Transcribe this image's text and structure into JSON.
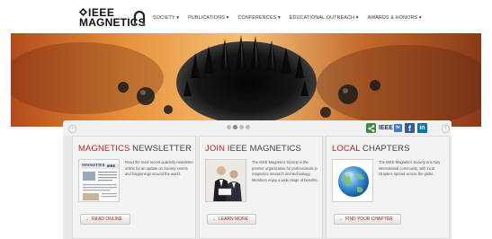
{
  "header": {
    "logo_line1": "IEEE",
    "logo_line2": "MAGNETICS",
    "nav": [
      {
        "label": "SOCIETY"
      },
      {
        "label": "PUBLICATIONS"
      },
      {
        "label": "CONFERENCES"
      },
      {
        "label": "EDUCATIONAL OUTREACH"
      },
      {
        "label": "AWARDS & HONORS"
      }
    ]
  },
  "slider": {
    "prev_icon": "chevron-left-icon",
    "next_icon": "chevron-right-icon",
    "dot_count": 4,
    "active_dot": 1
  },
  "social": {
    "share_icon": "share-icon",
    "ieee_tv_label": "IEEE",
    "tv_badge": "tv",
    "facebook_label": "f",
    "linkedin_label": "in"
  },
  "cards": [
    {
      "title_accent": "MAGNETICS",
      "title_rest": " NEWSLETTER",
      "text": "Read the most recent quarterly newsletter online for an update on Society events and happenings around the world.",
      "button": "READ ONLINE",
      "thumb_title": "NEWSLETTER",
      "thumb_brand": "IEEE"
    },
    {
      "title_accent": "JOIN",
      "title_rest": " IEEE MAGNETICS",
      "text": "The IEEE Magnetics Society is the premier organization for professionals in magnetics research and technology. Members enjoy a wide range of benefits.",
      "button": "LEARN MORE"
    },
    {
      "title_accent": "LOCAL",
      "title_rest": " CHAPTERS",
      "text": "The IEEE Magnetics Society is a truly international community, with local chapters spread across the globe.",
      "button": "FIND YOUR CHAPTER"
    }
  ],
  "colors": {
    "accent_red": "#c01f1f",
    "hero_orange": "#e07a2c"
  }
}
